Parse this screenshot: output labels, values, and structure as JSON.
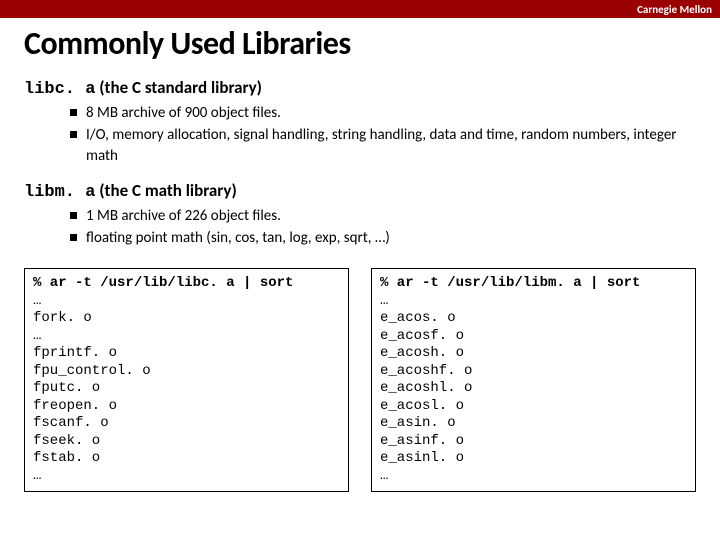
{
  "brand": "Carnegie Mellon",
  "title": "Commonly Used Libraries",
  "libc": {
    "name": "libc. a",
    "desc": "(the C standard library)",
    "bullets": [
      "8 MB archive of 900 object files.",
      "I/O, memory allocation, signal handling, string handling, data and time, random numbers, integer math"
    ]
  },
  "libm": {
    "name": "libm. a",
    "desc": "(the C math library)",
    "bullets": [
      "1 MB archive of 226 object files.",
      "floating point math (sin, cos, tan, log, exp, sqrt, …)"
    ]
  },
  "left_cmd": "% ar -t /usr/lib/libc. a | sort",
  "left_body": "…\nfork. o\n…\nfprintf. o\nfpu_control. o\nfputc. o\nfreopen. o\nfscanf. o\nfseek. o\nfstab. o\n…",
  "right_cmd": "% ar -t /usr/lib/libm. a | sort",
  "right_body": "…\ne_acos. o\ne_acosf. o\ne_acosh. o\ne_acoshf. o\ne_acoshl. o\ne_acosl. o\ne_asin. o\ne_asinf. o\ne_asinl. o\n…"
}
